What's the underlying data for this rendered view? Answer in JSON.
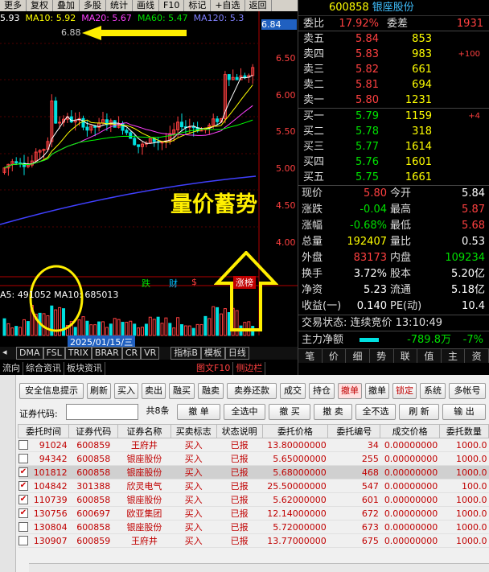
{
  "toolbar": {
    "items": [
      "更多",
      "复权",
      "叠加",
      "多股",
      "统计",
      "画线",
      "F10",
      "标记",
      "+自选",
      "返回"
    ]
  },
  "ma_legend": {
    "ma5": "5.93",
    "ma10": "MA10: 5.92",
    "ma20": "MA20: 5.67",
    "ma60": "MA60: 5.47",
    "ma120": "MA120: 5.3"
  },
  "price_axis": [
    "6.84",
    "6.50",
    "6.00",
    "5.50",
    "5.00",
    "4.50",
    "4.00"
  ],
  "high_label": "6.88",
  "annotation": "量价蓄势",
  "badges": {
    "b1": "跌",
    "b2": "财",
    "b3": "$",
    "b4": "涨榜"
  },
  "vol_legend": "A5: 491052  MA10: 685013",
  "date_label": "2025/01/15/三",
  "indicator_tabs": [
    "DMA",
    "FSL",
    "TRIX",
    "BRAR",
    "CR",
    "VR",
    "指标B",
    "模板",
    "日线"
  ],
  "bottom_tabs": [
    "流向",
    "综合资讯",
    "板块资讯",
    "图文F10",
    "侧边栏"
  ],
  "quote": {
    "code": "600858",
    "name": "银座股份",
    "wb_label": "委比",
    "wb": "17.92%",
    "wc_label": "委差",
    "wc": "1931",
    "asks": [
      {
        "l": "卖五",
        "p": "5.84",
        "v": "853",
        "c": ""
      },
      {
        "l": "卖四",
        "p": "5.83",
        "v": "983",
        "c": "+100"
      },
      {
        "l": "卖三",
        "p": "5.82",
        "v": "661",
        "c": ""
      },
      {
        "l": "卖二",
        "p": "5.81",
        "v": "694",
        "c": ""
      },
      {
        "l": "卖一",
        "p": "5.80",
        "v": "1231",
        "c": ""
      }
    ],
    "bids": [
      {
        "l": "买一",
        "p": "5.79",
        "v": "1159",
        "c": "+4"
      },
      {
        "l": "买二",
        "p": "5.78",
        "v": "318",
        "c": ""
      },
      {
        "l": "买三",
        "p": "5.77",
        "v": "1614",
        "c": ""
      },
      {
        "l": "买四",
        "p": "5.76",
        "v": "1601",
        "c": ""
      },
      {
        "l": "买五",
        "p": "5.75",
        "v": "1661",
        "c": ""
      }
    ],
    "stats": [
      {
        "a": "现价",
        "av": "5.80",
        "b": "今开",
        "bv": "5.84"
      },
      {
        "a": "涨跌",
        "av": "-0.04",
        "b": "最高",
        "bv": "5.87"
      },
      {
        "a": "涨幅",
        "av": "-0.68%",
        "b": "最低",
        "bv": "5.68"
      },
      {
        "a": "总量",
        "av": "192407",
        "b": "量比",
        "bv": "0.53"
      },
      {
        "a": "外盘",
        "av": "83173",
        "b": "内盘",
        "bv": "109234"
      },
      {
        "a": "换手",
        "av": "3.72%",
        "b": "股本",
        "bv": "5.20亿"
      },
      {
        "a": "净资",
        "av": "5.23",
        "b": "流通",
        "bv": "5.18亿"
      },
      {
        "a": "收益(一)",
        "av": "0.140",
        "b": "PE(动)",
        "bv": "10.4"
      }
    ],
    "status": "交易状态: 连续竞价 13:10:49",
    "zl_label": "主力净额",
    "zl_value": "-789.8万",
    "zl_pct": "-7%",
    "side_tabs": [
      "笔",
      "价",
      "细",
      "势",
      "联",
      "值",
      "主",
      "资"
    ]
  },
  "trade": {
    "buttons": [
      "安全信息提示",
      "刷新",
      "买入",
      "卖出",
      "融买",
      "融卖",
      "卖券还款",
      "成交",
      "持仓",
      "撤单",
      "撤单",
      "锁定",
      "系统",
      "多帐号"
    ],
    "code_label": "证券代码:",
    "count": "共8条",
    "ops": [
      "撤 单",
      "全选中",
      "撤 买",
      "撤 卖",
      "全不选",
      "刷 新",
      "输 出"
    ],
    "headers": [
      "委托时间",
      "证券代码",
      "证券名称",
      "买卖标志",
      "状态说明",
      "委托价格",
      "委托编号",
      "成交价格",
      "委托数量"
    ],
    "rows": [
      {
        "checked": false,
        "cols": [
          "91024",
          "600859",
          "王府井",
          "买入",
          "已报",
          "13.80000000",
          "34",
          "0.00000000",
          "1000.0"
        ]
      },
      {
        "checked": false,
        "cols": [
          "94342",
          "600858",
          "银座股份",
          "买入",
          "已报",
          "5.65000000",
          "255",
          "0.00000000",
          "1000.0"
        ]
      },
      {
        "checked": true,
        "cols": [
          "101812",
          "600858",
          "银座股份",
          "买入",
          "已报",
          "5.68000000",
          "468",
          "0.00000000",
          "1000.0"
        ]
      },
      {
        "checked": true,
        "cols": [
          "104842",
          "301388",
          "欣灵电气",
          "买入",
          "已报",
          "25.50000000",
          "547",
          "0.00000000",
          "100.0"
        ]
      },
      {
        "checked": true,
        "cols": [
          "110739",
          "600858",
          "银座股份",
          "买入",
          "已报",
          "5.62000000",
          "601",
          "0.00000000",
          "1000.0"
        ]
      },
      {
        "checked": true,
        "cols": [
          "130756",
          "600697",
          "欧亚集团",
          "买入",
          "已报",
          "12.14000000",
          "672",
          "0.00000000",
          "1000.0"
        ]
      },
      {
        "checked": false,
        "cols": [
          "130804",
          "600858",
          "银座股份",
          "买入",
          "已报",
          "5.72000000",
          "673",
          "0.00000000",
          "1000.0"
        ]
      },
      {
        "checked": false,
        "cols": [
          "130907",
          "600859",
          "王府井",
          "买入",
          "已报",
          "13.77000000",
          "675",
          "0.00000000",
          "1000.0"
        ]
      }
    ]
  },
  "colors": {
    "up": "#ff4040",
    "down": "#00e0e0",
    "ma5": "#ffffff",
    "ma10": "#ffff00",
    "ma20": "#ff40ff",
    "ma60": "#00ff00",
    "ma120": "#4040ff"
  }
}
